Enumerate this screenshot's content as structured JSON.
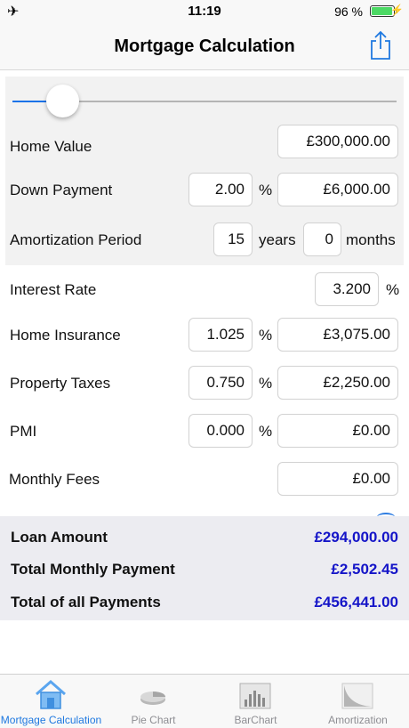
{
  "status_bar": {
    "time": "11:19",
    "battery_percent": "96 %",
    "battery_level": 0.96
  },
  "nav": {
    "title": "Mortgage Calculation",
    "share_icon": "share-icon"
  },
  "slider": {
    "value_fraction": 0.13
  },
  "form": {
    "home_value": {
      "label": "Home Value",
      "value": "£300,000.00"
    },
    "down_payment": {
      "label": "Down Payment",
      "percent": "2.00",
      "percent_unit": "%",
      "amount": "£6,000.00"
    },
    "amortization": {
      "label": "Amortization Period",
      "years": "15",
      "years_unit": "years",
      "months": "0",
      "months_unit": "months"
    },
    "interest_rate": {
      "label": "Interest Rate",
      "value": "3.200",
      "unit": "%"
    },
    "home_insurance": {
      "label": "Home Insurance",
      "percent": "1.025",
      "unit": "%",
      "amount": "£3,075.00"
    },
    "property_taxes": {
      "label": "Property Taxes",
      "percent": "0.750",
      "unit": "%",
      "amount": "£2,250.00"
    },
    "pmi": {
      "label": "PMI",
      "percent": "0.000",
      "unit": "%",
      "amount": "£0.00"
    },
    "monthly_fees": {
      "label": "Monthly Fees",
      "amount": "£0.00"
    }
  },
  "results": {
    "loan_amount": {
      "label": "Loan Amount",
      "value": "£294,000.00"
    },
    "total_monthly": {
      "label": "Total Monthly Payment",
      "value": "£2,502.45"
    },
    "total_all": {
      "label": "Total of all Payments",
      "value": "£456,441.00"
    }
  },
  "tabs": [
    {
      "label": "Mortgage Calculation",
      "icon": "house-icon",
      "active": true
    },
    {
      "label": "Pie Chart",
      "icon": "pie-chart-icon",
      "active": false
    },
    {
      "label": "BarChart",
      "icon": "bar-chart-icon",
      "active": false
    },
    {
      "label": "Amortization",
      "icon": "amortization-chart-icon",
      "active": false
    }
  ],
  "colors": {
    "accent": "#1e78e0",
    "result_value": "#1515c8",
    "battery": "#4cd964"
  }
}
